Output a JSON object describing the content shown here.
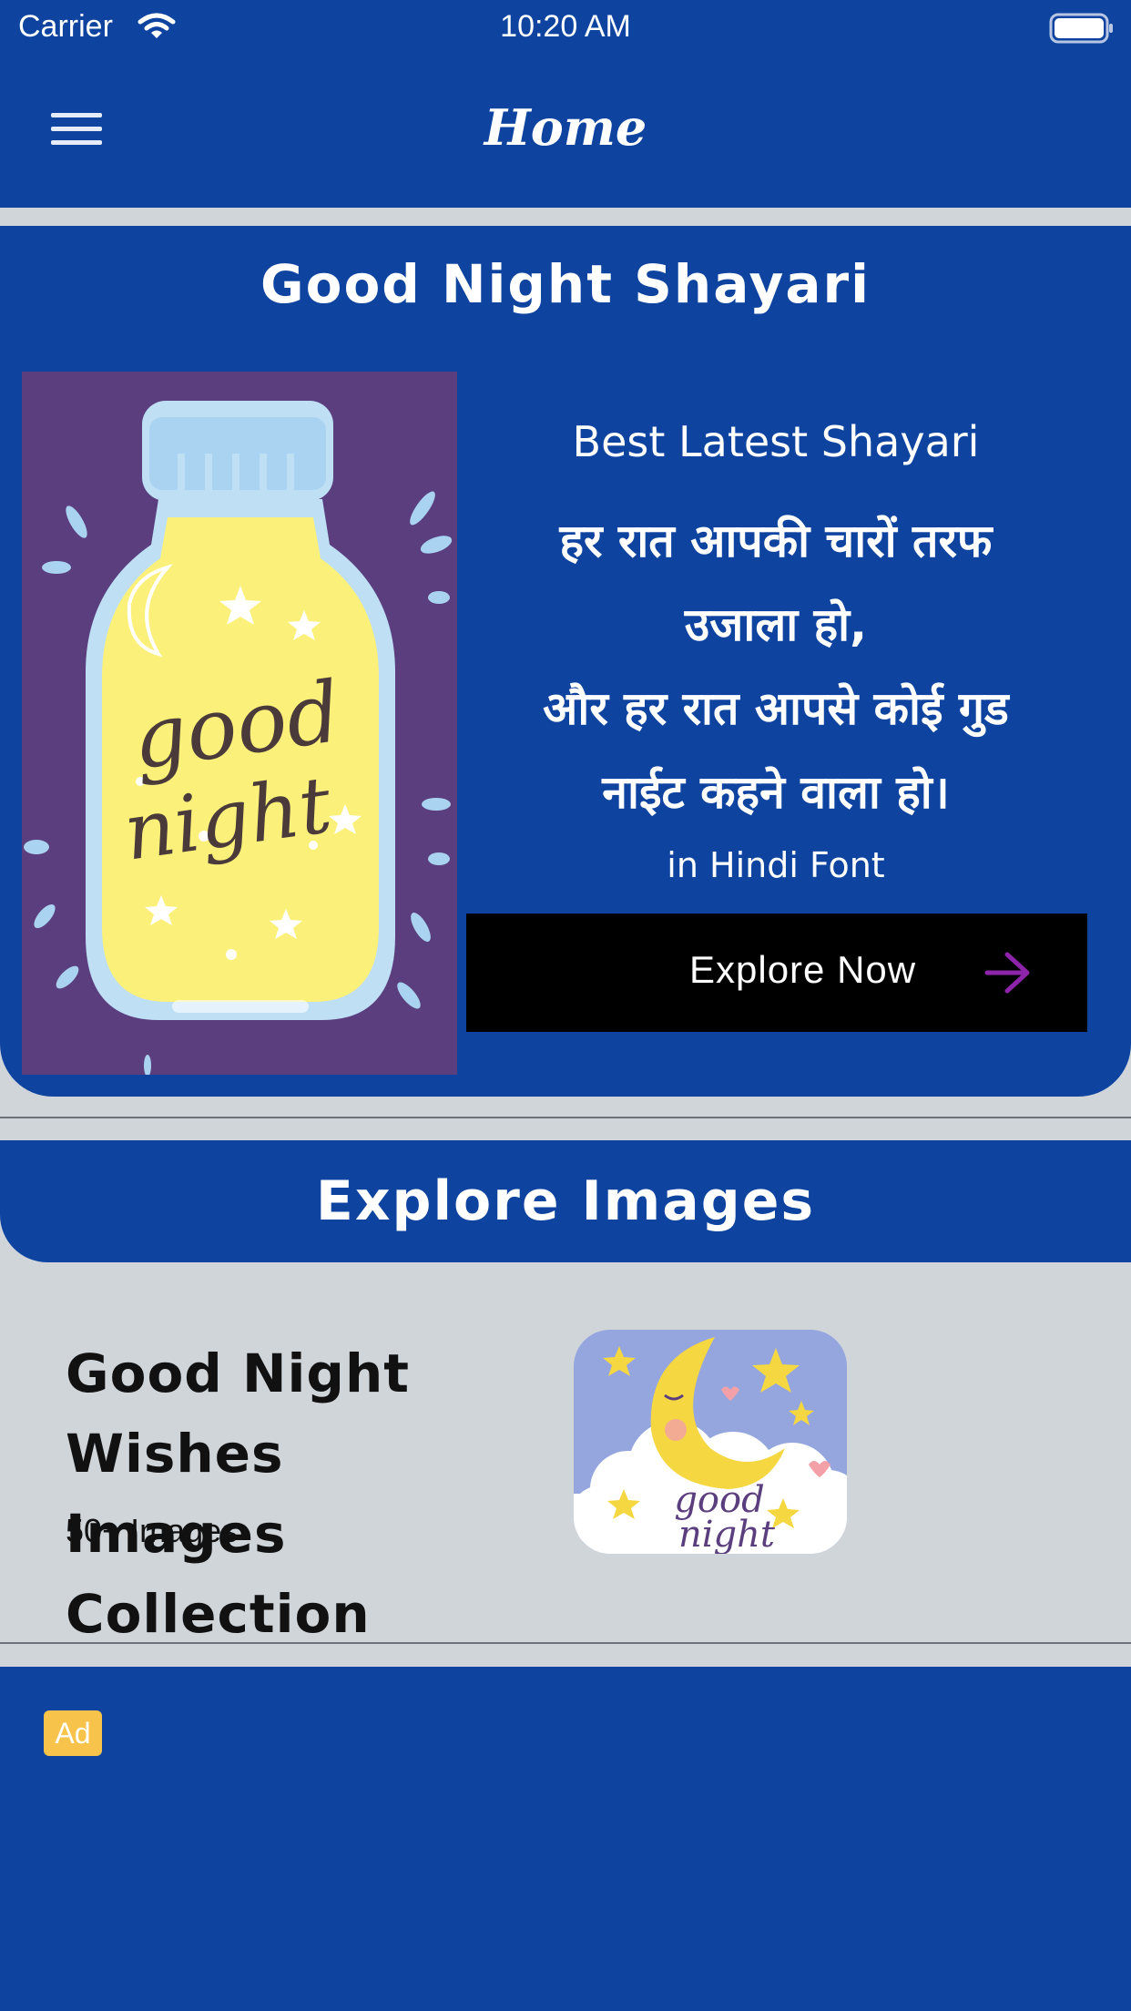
{
  "status_bar": {
    "carrier": "Carrier",
    "time": "10:20 AM"
  },
  "nav": {
    "title": "Home"
  },
  "shayari_card": {
    "title": "Good Night Shayari",
    "image_caption": "good night",
    "subtitle": "Best Latest Shayari",
    "quote_lines": [
      "हर रात आपकी चारों तरफ",
      "उजाला हो,",
      "और हर रात आपसे कोई गुड",
      "नाईट कहने वाला हो।"
    ],
    "font_note": "in Hindi Font",
    "button_label": "Explore Now",
    "accent_color": "#8e24aa"
  },
  "explore": {
    "header": "Explore Images",
    "collection": {
      "title_line1": "Good Night Wishes",
      "title_line2": "Images Collection",
      "count": "50+ Images",
      "image_caption_line1": "good",
      "image_caption_line2": "night"
    }
  },
  "ad": {
    "badge": "Ad"
  },
  "colors": {
    "primary": "#0e44a0",
    "background": "#d0d5da",
    "ad_badge": "#f8c34a"
  }
}
